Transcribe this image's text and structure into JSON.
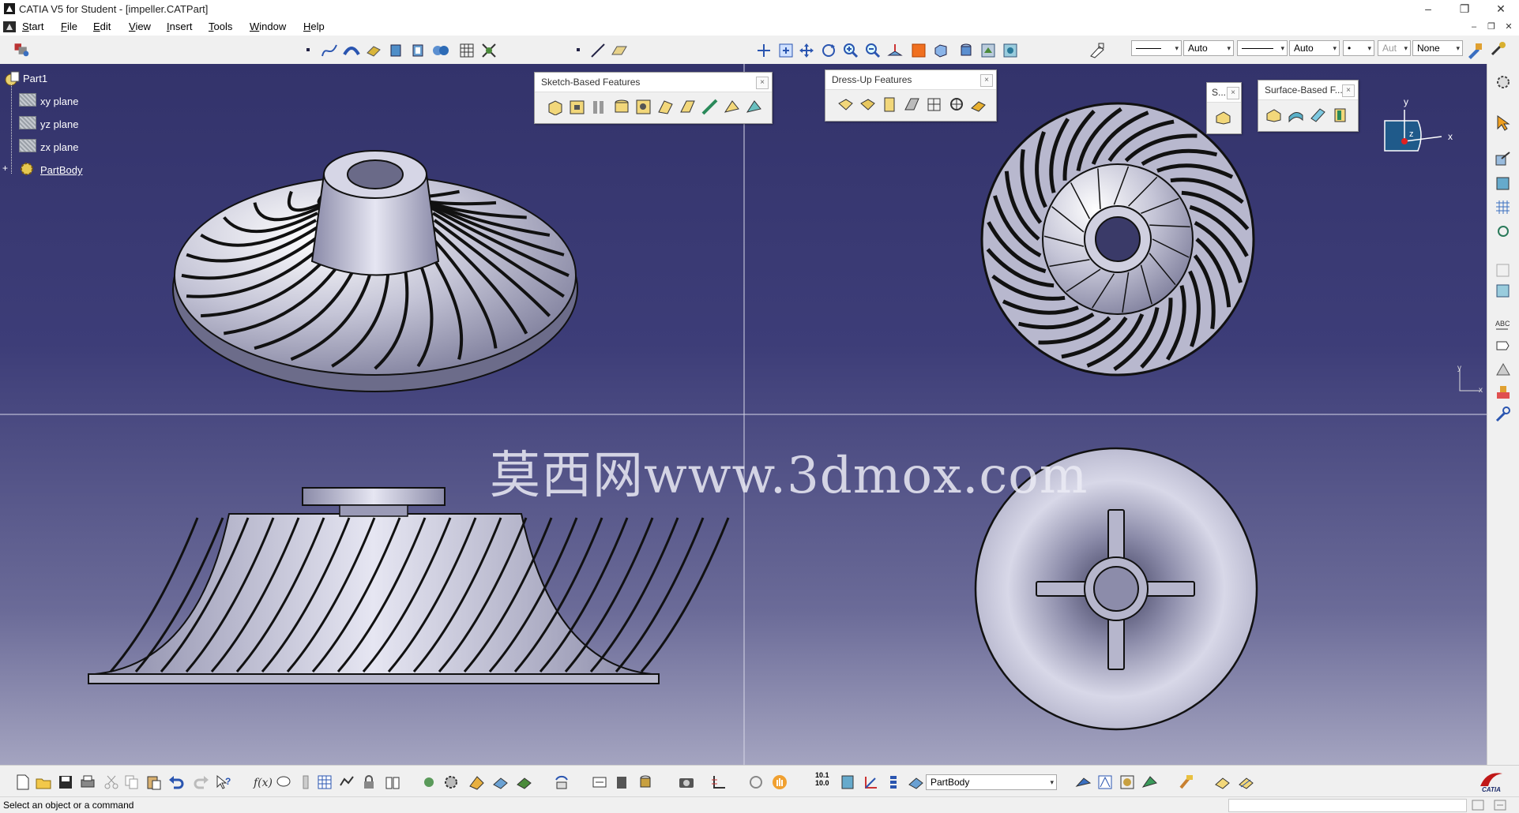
{
  "window": {
    "title": "CATIA V5 for Student - [impeller.CATPart]",
    "controls": [
      "–",
      "❐",
      "✕"
    ],
    "doc_controls": [
      "–",
      "❐",
      "✕"
    ]
  },
  "menu": [
    "Start",
    "File",
    "Edit",
    "View",
    "Insert",
    "Tools",
    "Window",
    "Help"
  ],
  "graphic_properties": {
    "line_weight": "Auto",
    "line_type": "Auto",
    "point": "•",
    "layer_auto": "Aut",
    "layer": "None"
  },
  "tree": {
    "root": "Part1",
    "planes": [
      "xy plane",
      "yz plane",
      "zx plane"
    ],
    "body": "PartBody"
  },
  "floating_toolbars": {
    "sketch": "Sketch-Based Features",
    "dressup": "Dress-Up Features",
    "small": "S...",
    "surface": "Surface-Based F...",
    "close": "×"
  },
  "compass": {
    "x": "x",
    "y": "y",
    "z": "z"
  },
  "watermark": "莫西网www.3dmox.com",
  "bottom": {
    "scale_readout": "10.1\n10.0",
    "current_body": "PartBody",
    "brand": "CATIA"
  },
  "status": "Select an object or a command",
  "colors": {
    "viewport_top": "#33336b",
    "viewport_bottom": "#a4a4c0",
    "part_metal": "#c8c8d8"
  }
}
